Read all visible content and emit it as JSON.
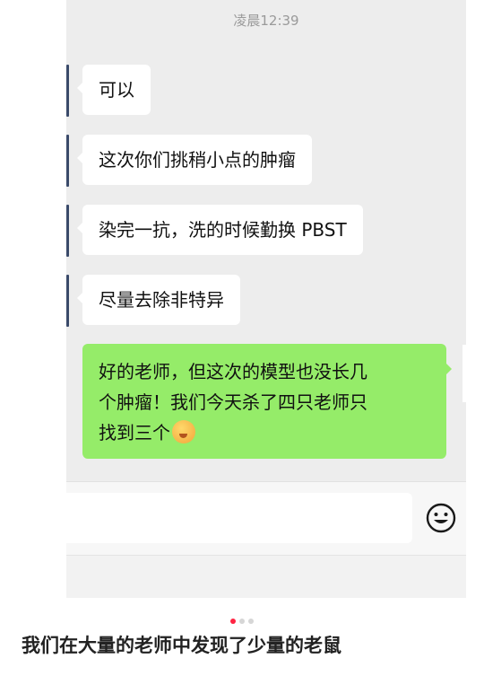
{
  "chat": {
    "timestamp": "凌晨12:39",
    "incoming": [
      "可以",
      "这次你们挑稍小点的肿瘤",
      "染完一抗，洗的时候勤换 PBST",
      "尽量去除非特异"
    ],
    "outgoing": {
      "line1": "好的老师，但这次的模型也没长几",
      "line2": "个肿瘤！我们今天杀了四只老师只",
      "line3": "找到三个"
    },
    "emoji_icon": "smirk-emoji-icon",
    "input_placeholder": "",
    "emoji_button_icon": "smile-face-icon"
  },
  "pager": {
    "count": 3,
    "active_index": 0
  },
  "caption": "我们在大量的老师中发现了少量的老鼠",
  "colors": {
    "outgoing_bubble": "#95ec69",
    "chat_background": "#ededed",
    "pager_active": "#ff2442"
  }
}
